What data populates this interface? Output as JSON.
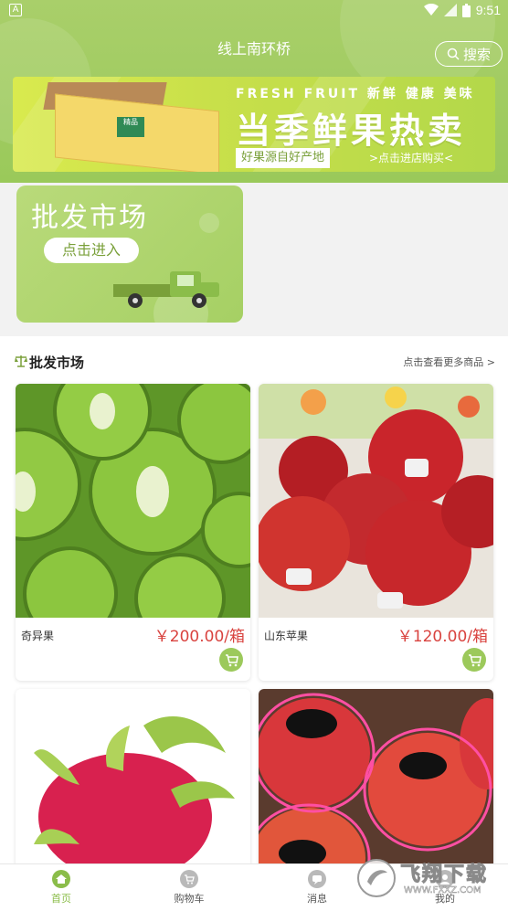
{
  "status": {
    "time": "9:51",
    "left_icon": "A"
  },
  "header": {
    "city": "线上南环桥",
    "search_label": "搜索",
    "bg_color": "#a6cf66"
  },
  "banner": {
    "line1": "FRESH FRUIT 新鲜 健康 美味",
    "line2": "当季鲜果热卖",
    "tagline": "好果源自好产地",
    "cta": ">点击进店购买<",
    "box_label": "精品"
  },
  "market_card": {
    "title": "批发市场",
    "enter_label": "点击进入"
  },
  "section": {
    "title": "批发市场",
    "more": "点击查看更多商品 >"
  },
  "products": [
    {
      "name": "奇异果",
      "price": "￥200.00/箱"
    },
    {
      "name": "山东苹果",
      "price": "￥120.00/箱"
    }
  ],
  "tabs": [
    {
      "label": "首页",
      "icon": "home-icon"
    },
    {
      "label": "购物车",
      "icon": "cart-icon"
    },
    {
      "label": "消息",
      "icon": "message-icon"
    },
    {
      "label": "我的",
      "icon": "user-icon"
    }
  ],
  "watermark": {
    "text": "飞翔下载",
    "url": "WWW.FXXZ.COM"
  },
  "colors": {
    "accent": "#8bbd4a",
    "price": "#d9433f"
  }
}
